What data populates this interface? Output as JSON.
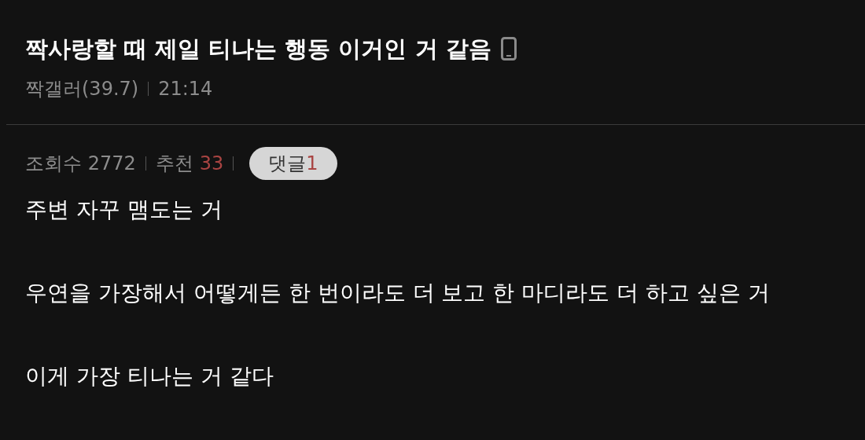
{
  "post": {
    "title": "짝사랑할 때 제일 티나는 행동 이거인 거 같음",
    "author": "짝갤러(39.7)",
    "time": "21:14"
  },
  "stats": {
    "views_label": "조회수",
    "views": "2772",
    "recommend_label": "추천",
    "recommend": "33",
    "comments_label": "댓글",
    "comments": "1"
  },
  "body": [
    "주변 자꾸 맴도는 거",
    "우연을 가장해서 어떻게든 한 번이라도 더 보고 한 마디라도 더 하고 싶은 거",
    "이게 가장 티나는 거 같다"
  ]
}
